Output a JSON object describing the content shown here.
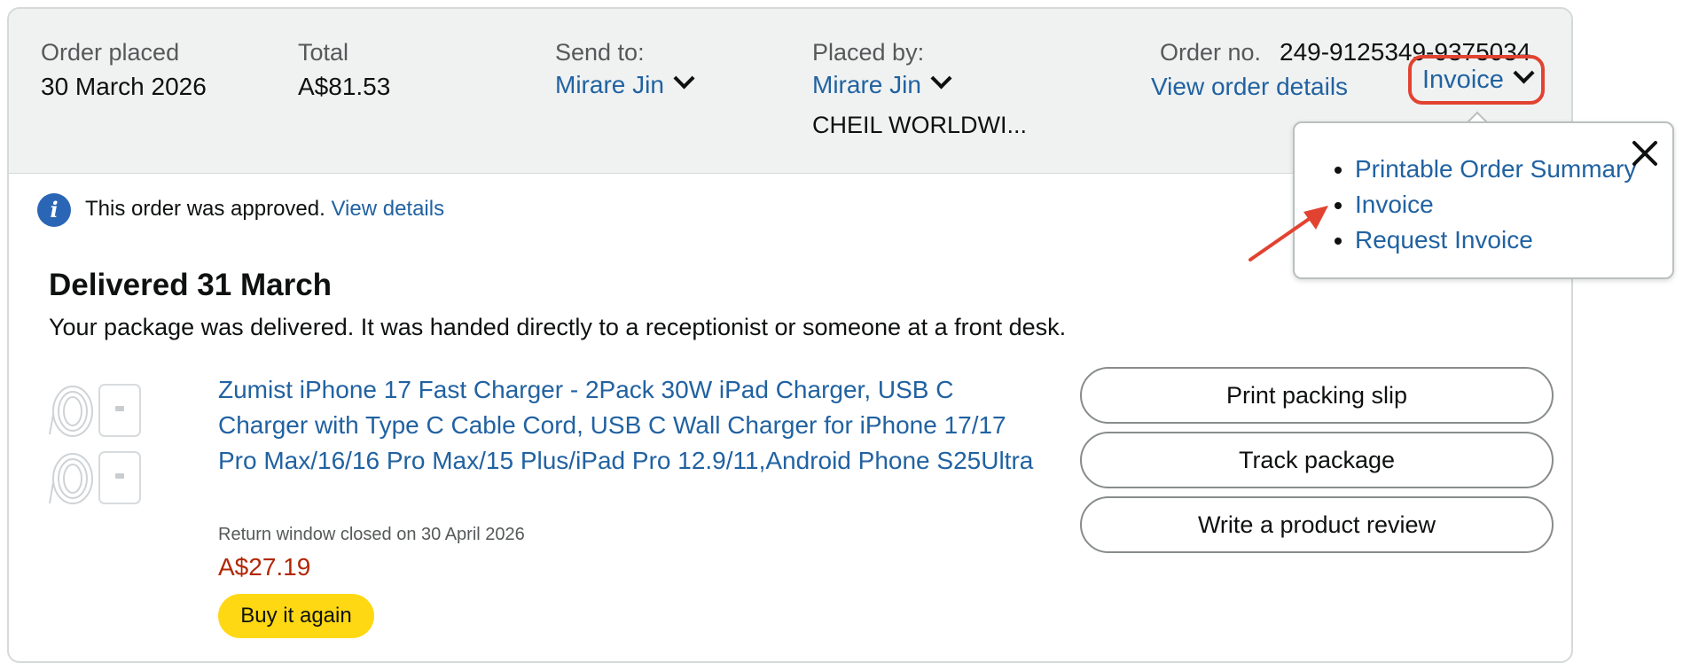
{
  "header": {
    "order_placed_label": "Order placed",
    "order_placed_value": "30 March 2026",
    "total_label": "Total",
    "total_value": "A$81.53",
    "send_to_label": "Send to:",
    "send_to_value": "Mirare Jin",
    "placed_by_label": "Placed by:",
    "placed_by_value": "Mirare Jin",
    "placed_by_company": "CHEIL WORLDWI...",
    "order_no_label": "Order no.",
    "order_no_value": "249-9125349-9375034",
    "view_order_details": "View order details",
    "invoice_label": "Invoice"
  },
  "invoice_menu": {
    "items": [
      "Printable Order Summary",
      "Invoice",
      "Request Invoice"
    ],
    "highlight_color": "#e24331"
  },
  "alert": {
    "text": "This order was approved.",
    "link": "View details"
  },
  "shipment": {
    "status": "Delivered 31 March",
    "description": "Your package was delivered. It was handed directly to a receptionist or someone at a front desk."
  },
  "product": {
    "title": "Zumist iPhone 17 Fast Charger - 2Pack 30W iPad Charger, USB C Charger with Type C Cable Cord, USB C Wall Charger for iPhone 17/17 Pro Max/16/16 Pro Max/15 Plus/iPad Pro 12.9/11,Android Phone S25Ultra",
    "return_note": "Return window closed on 30 April 2026",
    "price": "A$27.19",
    "buy_again": "Buy it again"
  },
  "actions": {
    "print_packing_slip": "Print packing slip",
    "track_package": "Track package",
    "write_review": "Write a product review"
  },
  "colors": {
    "link": "#2162a1",
    "header_bg": "#f0f2f2",
    "price": "#b12704",
    "buy_again_bg": "#ffd814",
    "annotation": "#e24331"
  }
}
